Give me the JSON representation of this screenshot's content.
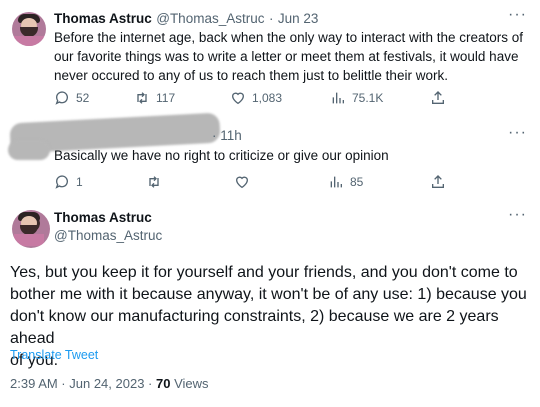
{
  "tweet1": {
    "name": "Thomas Astruc",
    "handle": "@Thomas_Astruc",
    "separator": "·",
    "date": "Jun 23",
    "text_lines": [
      "Before the internet age, back when the only way to interact with the creators of",
      "our favorite things was to write a letter or meet them at festivals, it would have",
      "never occured to any of us to reach them just to belittle their work."
    ],
    "actions": {
      "replies": "52",
      "retweets": "117",
      "likes": "1,083",
      "views": "75.1K"
    }
  },
  "tweet2": {
    "time": "· 11h",
    "text": "Basically we have no right to criticize or give our opinion",
    "actions": {
      "replies": "1",
      "retweets": "",
      "likes": "",
      "views": "85"
    }
  },
  "tweet3": {
    "name": "Thomas Astruc",
    "handle": "@Thomas_Astruc",
    "text_lines": [
      "Yes, but you keep it for yourself and your friends, and you don't come to",
      "bother me with it because anyway, it won't be of any use: 1) because you",
      "don't know our manufacturing constraints, 2) because we are 2 years ahead",
      "of you."
    ],
    "translate": "Translate Tweet",
    "timestamp": "2:39 AM · Jun 24, 2023 ·",
    "views_count": "70",
    "views_label": "Views"
  },
  "more_label": "···"
}
